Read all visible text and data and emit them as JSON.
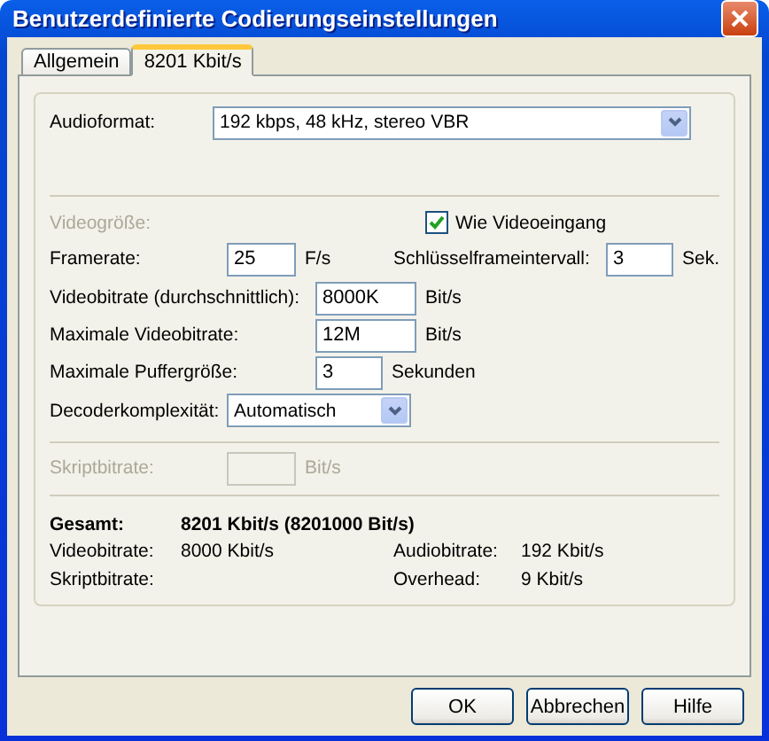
{
  "window": {
    "title": "Benutzerdefinierte Codierungseinstellungen"
  },
  "tabs": [
    {
      "label": "Allgemein",
      "selected": false
    },
    {
      "label": "8201 Kbit/s",
      "selected": true
    }
  ],
  "audio_format": {
    "label": "Audioformat:",
    "value": "192 kbps, 48 kHz, stereo VBR"
  },
  "video_size": {
    "label": "Videogröße:",
    "disabled": true
  },
  "same_as_input": {
    "label": "Wie Videoeingang",
    "checked": true
  },
  "framerate": {
    "label": "Framerate:",
    "value": "25",
    "unit": "F/s"
  },
  "keyframe_interval": {
    "label": "Schlüsselframeintervall:",
    "value": "3",
    "unit": "Sek."
  },
  "bitrate_fields": [
    {
      "label": "Videobitrate (durchschnittlich):",
      "value": "8000K",
      "unit": "Bit/s",
      "kind": "wide"
    },
    {
      "label": "Maximale Videobitrate:",
      "value": "12M",
      "unit": "Bit/s",
      "kind": "wide"
    },
    {
      "label": "Maximale Puffergröße:",
      "value": "3",
      "unit": "Sekunden",
      "kind": "narrow"
    }
  ],
  "decoder_complexity": {
    "label": "Decoderkomplexität:",
    "value": "Automatisch"
  },
  "script_bitrate": {
    "label": "Skriptbitrate:",
    "unit": "Bit/s",
    "disabled": true
  },
  "total": {
    "label": "Gesamt:",
    "value": "8201 Kbit/s (8201000 Bit/s)"
  },
  "summary": [
    {
      "label": "Videobitrate:",
      "value": "8000 Kbit/s"
    },
    {
      "label": "Audiobitrate:",
      "value": "192 Kbit/s"
    },
    {
      "label": "Skriptbitrate:"
    },
    {
      "label": "Overhead:",
      "value": "9 Kbit/s"
    }
  ],
  "buttons": [
    {
      "label": "OK"
    },
    {
      "label": "Abbrechen"
    },
    {
      "label": "Hilfe"
    }
  ]
}
